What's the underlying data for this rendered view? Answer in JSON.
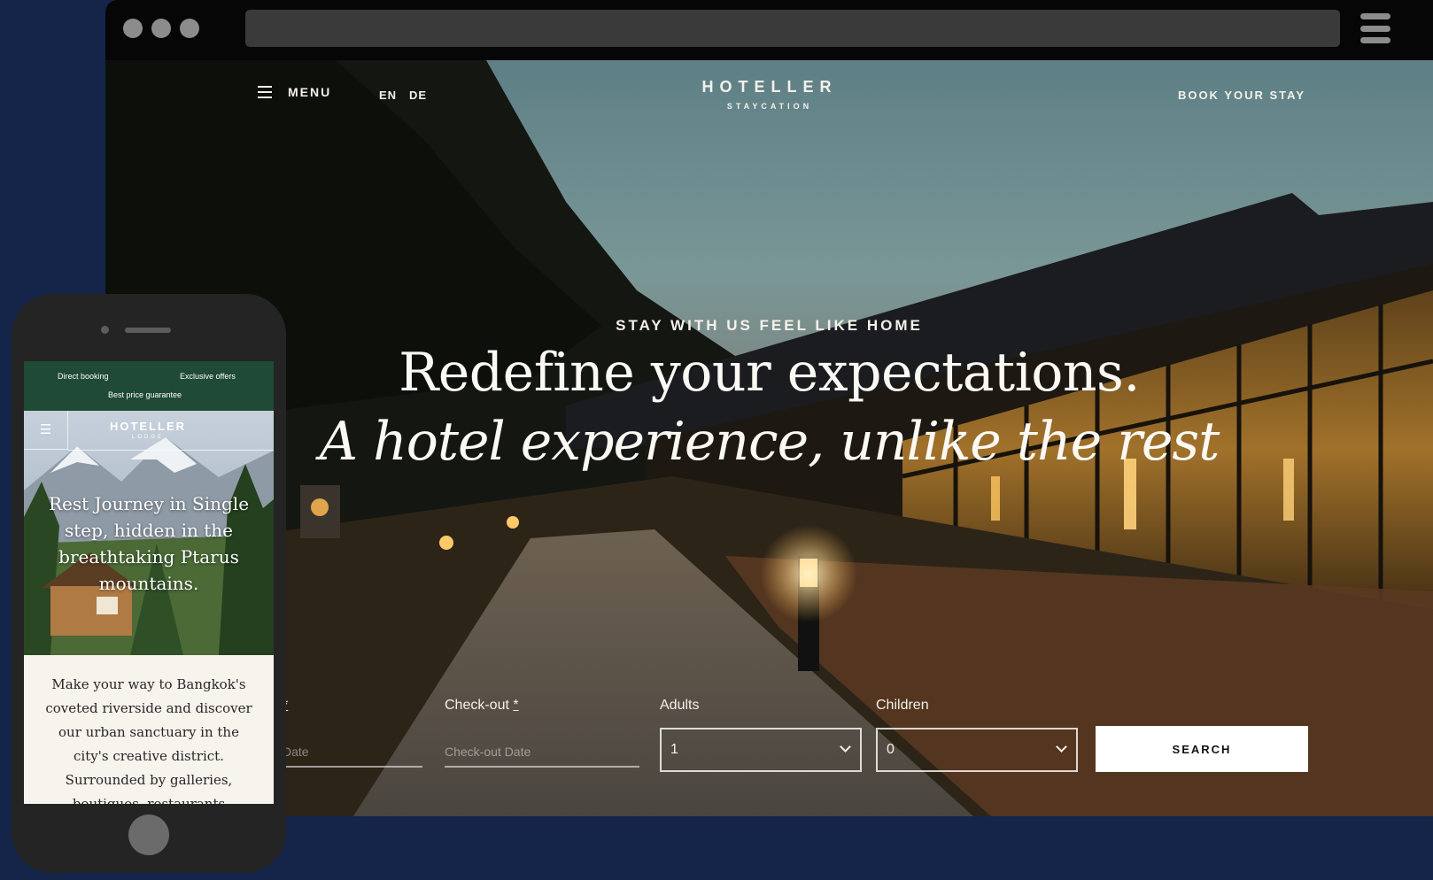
{
  "browser": {
    "window_dots": [
      "#8c8c8c",
      "#8c8c8c",
      "#8c8c8c"
    ],
    "menu_icon": "hamburger-icon"
  },
  "site": {
    "nav": {
      "menu_label": "MENU",
      "languages": [
        "EN",
        "DE"
      ],
      "book_label": "BOOK YOUR STAY"
    },
    "logo": {
      "name": "HOTELLER",
      "tagline": "STAYCATION"
    },
    "hero": {
      "eyebrow": "STAY WITH US FEEL LIKE HOME",
      "headline": "Redefine your expectations.",
      "headline_italic": "A hotel experience, unlike the rest"
    },
    "booking": {
      "checkin_label": "*",
      "checkin_placeholder": "Date",
      "checkout_label": "Check-out",
      "checkout_required": "*",
      "checkout_placeholder": "Check-out Date",
      "adults_label": "Adults",
      "adults_value": "1",
      "children_label": "Children",
      "children_value": "0",
      "search_label": "SEARCH"
    }
  },
  "mobile": {
    "promo": [
      "Direct booking",
      "Exclusive offers",
      "Best price guarantee"
    ],
    "logo": {
      "name": "HOTELLER",
      "tagline": "LODGE"
    },
    "hero_title": "Rest Journey in Single step, hidden in the breathtaking Ptarus mountains.",
    "body_text": "Make your way to Bangkok's coveted riverside and discover our urban sanctuary in the city's creative district. Surrounded by galleries, boutiques, restaurants"
  },
  "colors": {
    "page_background": "#15254a",
    "promo_bar": "#1f4a35",
    "search_button": "#ffffff"
  }
}
